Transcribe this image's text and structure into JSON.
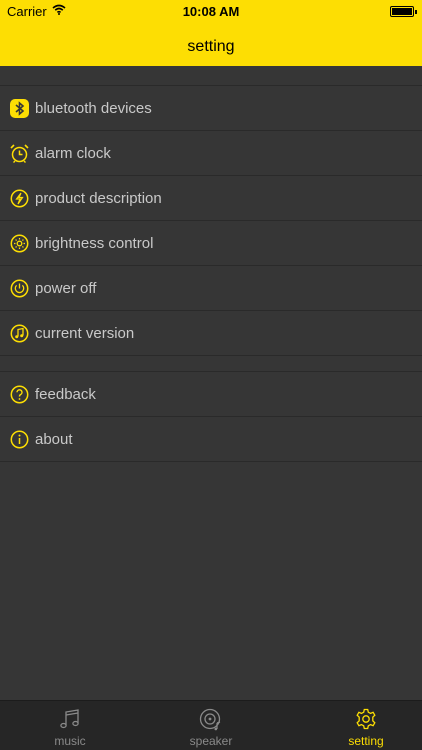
{
  "status_bar": {
    "carrier": "Carrier",
    "time": "10:08 AM"
  },
  "nav": {
    "title": "setting"
  },
  "accent_color": "#fdde03",
  "menu": {
    "group1": [
      {
        "label": "bluetooth devices",
        "icon": "bluetooth-icon"
      },
      {
        "label": "alarm clock",
        "icon": "alarm-clock-icon"
      },
      {
        "label": "product description",
        "icon": "product-description-icon"
      },
      {
        "label": "brightness control",
        "icon": "brightness-icon"
      },
      {
        "label": "power off",
        "icon": "power-icon"
      },
      {
        "label": "current version",
        "icon": "music-note-icon"
      }
    ],
    "group2": [
      {
        "label": "feedback",
        "icon": "question-icon"
      },
      {
        "label": "about",
        "icon": "info-icon"
      }
    ]
  },
  "tabbar": {
    "items": [
      {
        "label": "music",
        "icon": "music-icon",
        "active": false
      },
      {
        "label": "speaker",
        "icon": "speaker-icon",
        "active": false
      },
      {
        "label": "setting",
        "icon": "gear-icon",
        "active": true
      }
    ]
  }
}
